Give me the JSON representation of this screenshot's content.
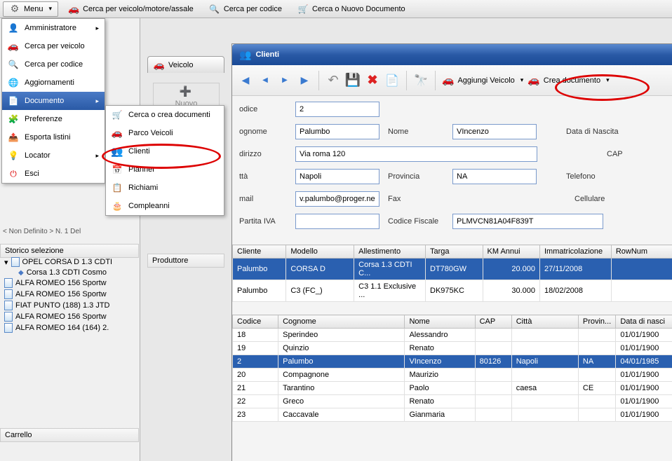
{
  "topbar": {
    "menu": "Menu",
    "search_vehicle": "Cerca per veicolo/motore/assale",
    "search_code": "Cerca per codice",
    "search_doc": "Cerca o Nuovo Documento"
  },
  "main_menu": {
    "items": [
      {
        "label": "Amministratore",
        "icon": "user-icon",
        "arrow": true
      },
      {
        "label": "Cerca per veicolo",
        "icon": "car-icon"
      },
      {
        "label": "Cerca per codice",
        "icon": "search-code-icon"
      },
      {
        "label": "Aggiornamenti",
        "icon": "globe-icon"
      },
      {
        "label": "Documento",
        "icon": "doc-icon2",
        "arrow": true,
        "highlighted": true
      },
      {
        "label": "Preferenze",
        "icon": "pref-icon"
      },
      {
        "label": "Esporta listini",
        "icon": "export-icon"
      },
      {
        "label": "Locator",
        "icon": "locator-icon",
        "arrow": true
      },
      {
        "label": "Esci",
        "icon": "exit-icon"
      }
    ]
  },
  "submenu": {
    "items": [
      {
        "label": "Cerca o crea documenti",
        "icon": "cart-icon"
      },
      {
        "label": "Parco Veicoli",
        "icon": "car-icon"
      },
      {
        "label": "Clienti",
        "icon": "users-icon"
      },
      {
        "label": "Planner",
        "icon": "planner-icon"
      },
      {
        "label": "Richiami",
        "icon": "recall-icon"
      },
      {
        "label": "Compleanni",
        "icon": "birthday-icon"
      }
    ]
  },
  "left": {
    "breadcrumb": "< Non Definito > N. 1 Del",
    "history_header": "Storico selezione",
    "history": [
      {
        "label": "OPEL CORSA D 1.3 CDTI",
        "root": true
      },
      {
        "label": "Corsa 1.3 CDTI Cosmo",
        "child": true
      },
      {
        "label": "ALFA ROMEO 156 Sportw"
      },
      {
        "label": "ALFA ROMEO 156 Sportw"
      },
      {
        "label": "FIAT PUNTO (188) 1.3 JTD"
      },
      {
        "label": "ALFA ROMEO 156 Sportw"
      },
      {
        "label": "ALFA ROMEO 164 (164) 2."
      }
    ],
    "carrello": "Carrello"
  },
  "veicolo_tab": "Veicolo",
  "nuovo": "Nuovo",
  "produttore": "Produttore",
  "clienti": {
    "title": "Clienti",
    "toolbar": {
      "add_vehicle": "Aggiungi Veicolo",
      "create_doc": "Crea documento"
    },
    "form": {
      "codice_lbl": "odice",
      "codice": "2",
      "cognome_lbl": "ognome",
      "cognome": "Palumbo",
      "nome_lbl": "Nome",
      "nome": "VIncenzo",
      "nascita_lbl": "Data di Nascita",
      "indirizzo_lbl": "dirizzo",
      "indirizzo": "Via roma 120",
      "cap_lbl": "CAP",
      "citta_lbl": "ttà",
      "citta": "Napoli",
      "provincia_lbl": "Provincia",
      "provincia": "NA",
      "telefono_lbl": "Telefono",
      "email_lbl": "mail",
      "email": "v.palumbo@proger.net",
      "fax_lbl": "Fax",
      "cellulare_lbl": "Cellulare",
      "piva_lbl": "Partita IVA",
      "piva": "",
      "cf_lbl": "Codice Fiscale",
      "cf": "PLMVCN81A04F839T"
    },
    "grid1": {
      "headers": [
        "Cliente",
        "Modello",
        "Allestimento",
        "Targa",
        "KM Annui",
        "Immatricolazione",
        "RowNum"
      ],
      "rows": [
        {
          "cliente": "Palumbo",
          "modello": "CORSA D",
          "allest": "Corsa 1.3 CDTI C...",
          "targa": "DT780GW",
          "km": "20.000",
          "imm": "27/11/2008",
          "rn": "",
          "selected": true
        },
        {
          "cliente": "Palumbo",
          "modello": "C3 (FC_)",
          "allest": "C3 1.1 Exclusive ...",
          "targa": "DK975KC",
          "km": "30.000",
          "imm": "18/02/2008",
          "rn": ""
        }
      ]
    },
    "grid2": {
      "headers": [
        "Codice",
        "Cognome",
        "Nome",
        "CAP",
        "Città",
        "Provin...",
        "Data di nasci"
      ],
      "rows": [
        {
          "codice": "18",
          "cognome": "Sperindeo",
          "nome": "Alessandro",
          "cap": "",
          "citta": "",
          "prov": "",
          "nasc": "01/01/1900"
        },
        {
          "codice": "19",
          "cognome": "Quinzio",
          "nome": "Renato",
          "cap": "",
          "citta": "",
          "prov": "",
          "nasc": "01/01/1900"
        },
        {
          "codice": "2",
          "cognome": "Palumbo",
          "nome": "VIncenzo",
          "cap": "80126",
          "citta": "Napoli",
          "prov": "NA",
          "nasc": "04/01/1985",
          "selected": true
        },
        {
          "codice": "20",
          "cognome": "Compagnone",
          "nome": "Maurizio",
          "cap": "",
          "citta": "",
          "prov": "",
          "nasc": "01/01/1900"
        },
        {
          "codice": "21",
          "cognome": "Tarantino",
          "nome": "Paolo",
          "cap": "",
          "citta": "caesa",
          "prov": "CE",
          "nasc": "01/01/1900"
        },
        {
          "codice": "22",
          "cognome": "Greco",
          "nome": "Renato",
          "cap": "",
          "citta": "",
          "prov": "",
          "nasc": "01/01/1900"
        },
        {
          "codice": "23",
          "cognome": "Caccavale",
          "nome": "Gianmaria",
          "cap": "",
          "citta": "",
          "prov": "",
          "nasc": "01/01/1900"
        }
      ]
    }
  }
}
